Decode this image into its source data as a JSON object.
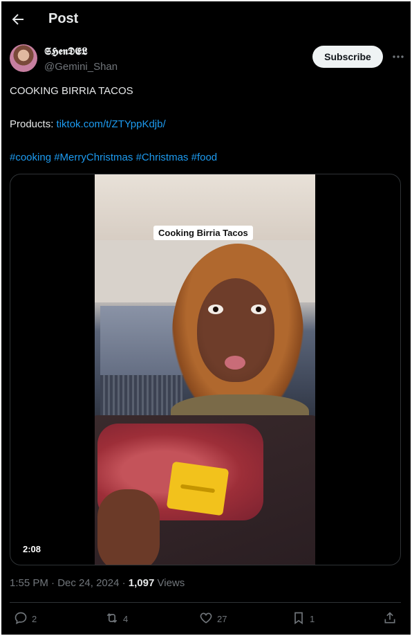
{
  "header": {
    "title": "Post"
  },
  "author": {
    "display_name": "𝕾𝕳𝖊𝖓𝕯𝕰𝕷",
    "handle": "@Gemini_Shan"
  },
  "subscribe_label": "Subscribe",
  "tweet": {
    "line1": "COOKING BIRRIA TACOS",
    "products_label": "Products: ",
    "products_link": "tiktok.com/t/ZTYppKdjb/",
    "hashtags": [
      "#cooking",
      "#MerryChristmas",
      "#Christmas",
      "#food"
    ]
  },
  "media": {
    "caption": "Cooking Birria Tacos",
    "duration": "2:08"
  },
  "meta": {
    "time": "1:55 PM",
    "separator": " · ",
    "date": "Dec 24, 2024",
    "views_count": "1,097",
    "views_label": " Views"
  },
  "actions": {
    "replies": "2",
    "reposts": "4",
    "likes": "27",
    "bookmarks": "1"
  },
  "colors": {
    "background": "#000000",
    "text": "#e7e9ea",
    "muted": "#71767b",
    "link": "#1d9bf0",
    "border": "#2f3336"
  },
  "icons": [
    "back-arrow-icon",
    "more-icon",
    "reply-icon",
    "repost-icon",
    "like-icon",
    "bookmark-icon",
    "share-icon"
  ]
}
